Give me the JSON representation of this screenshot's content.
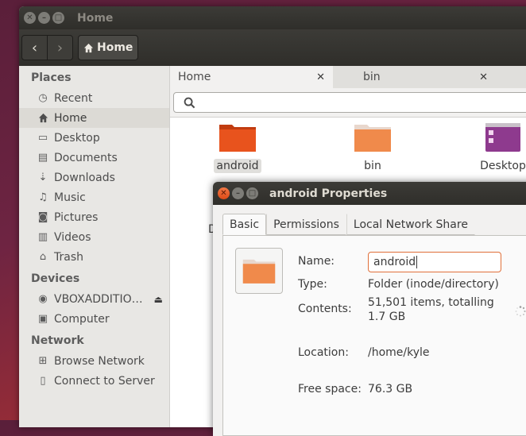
{
  "window": {
    "title": "Home"
  },
  "toolbar": {
    "path_label": "Home"
  },
  "sidebar": {
    "places_header": "Places",
    "places": [
      {
        "label": "Recent",
        "icon": "clock-icon"
      },
      {
        "label": "Home",
        "icon": "home-icon",
        "selected": true
      },
      {
        "label": "Desktop",
        "icon": "desktop-icon"
      },
      {
        "label": "Documents",
        "icon": "documents-icon"
      },
      {
        "label": "Downloads",
        "icon": "downloads-icon"
      },
      {
        "label": "Music",
        "icon": "music-icon"
      },
      {
        "label": "Pictures",
        "icon": "camera-icon"
      },
      {
        "label": "Videos",
        "icon": "film-icon"
      },
      {
        "label": "Trash",
        "icon": "trash-icon"
      }
    ],
    "devices_header": "Devices",
    "devices": [
      {
        "label": "VBOXADDITIO…",
        "icon": "disc-icon"
      },
      {
        "label": "Computer",
        "icon": "computer-icon"
      }
    ],
    "network_header": "Network",
    "network": [
      {
        "label": "Browse Network",
        "icon": "network-icon"
      },
      {
        "label": "Connect to Server",
        "icon": "server-icon"
      }
    ]
  },
  "tabs": [
    {
      "label": "Home",
      "active": true
    },
    {
      "label": "bin",
      "active": false
    }
  ],
  "files": [
    {
      "label": "android",
      "selected": true
    },
    {
      "label": "bin"
    },
    {
      "label": "Desktop"
    }
  ],
  "stray_letter": "D",
  "dialog": {
    "title": "android Properties",
    "tabs": [
      "Basic",
      "Permissions",
      "Local Network Share"
    ],
    "name_label": "Name:",
    "name_value": "android",
    "type_label": "Type:",
    "type_value": "Folder (inode/directory)",
    "contents_label": "Contents:",
    "contents_line1": "51,501 items, totalling",
    "contents_line2": "1.7 GB",
    "location_label": "Location:",
    "location_value": "/home/kyle",
    "free_label": "Free space:",
    "free_value": "76.3 GB"
  },
  "colors": {
    "accent": "#dd4814",
    "folder_orange": "#e95420",
    "desktop_purple": "#8e3a8e"
  }
}
